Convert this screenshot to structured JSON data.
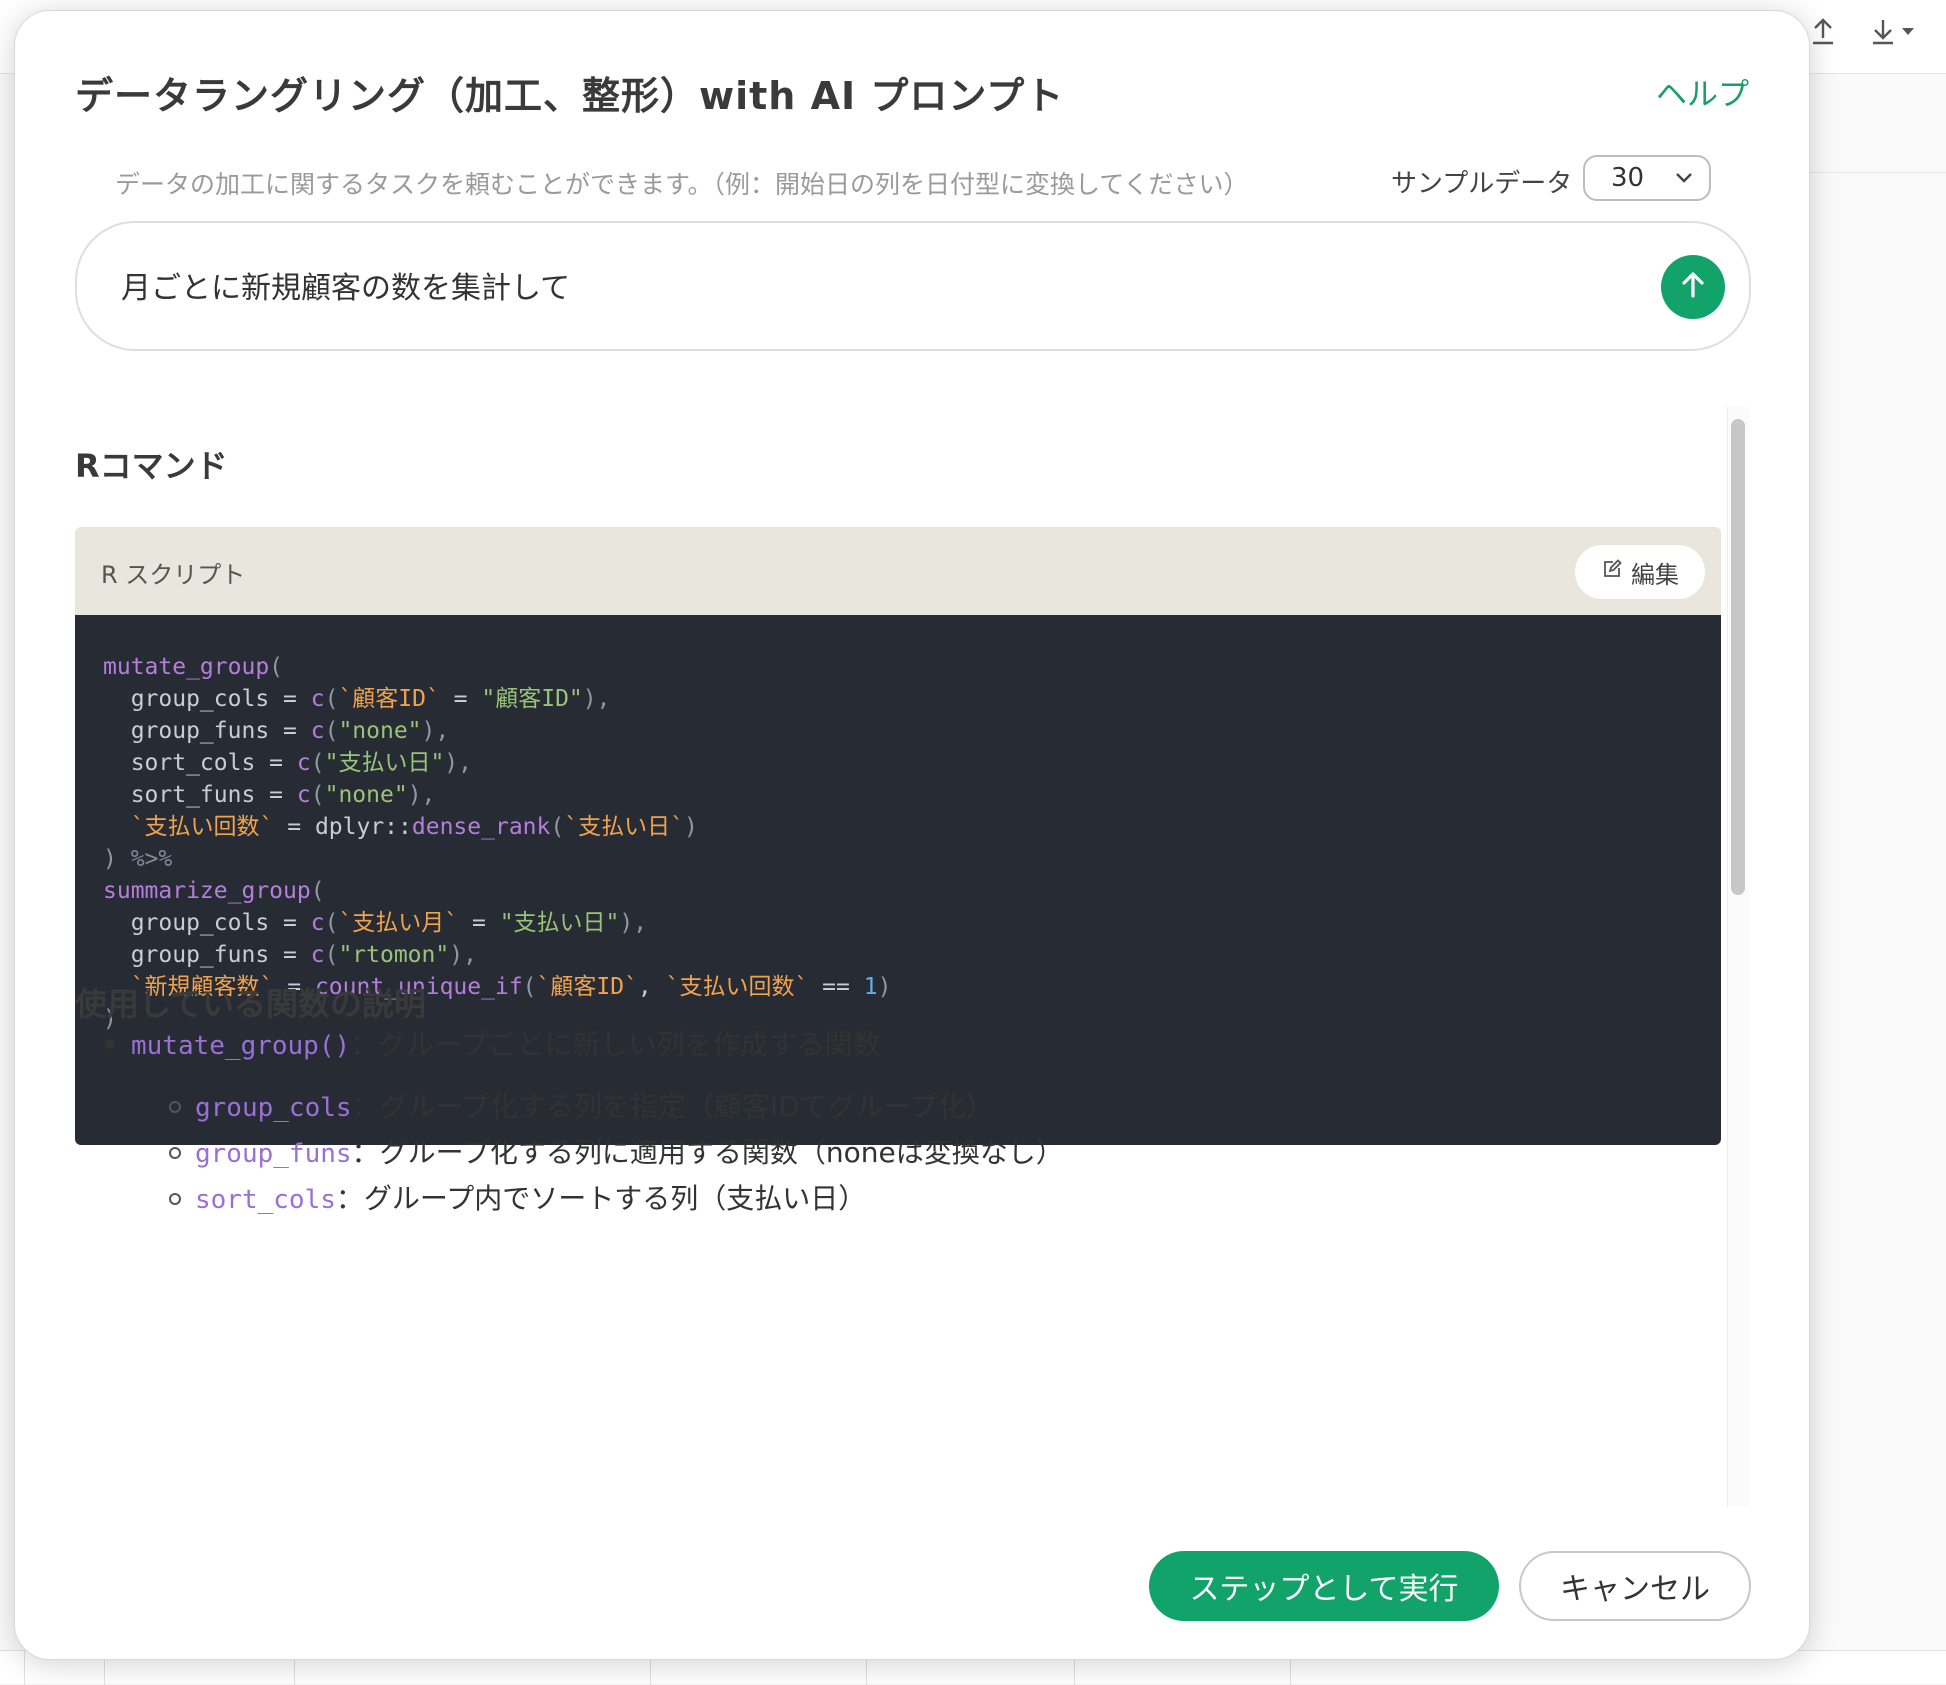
{
  "dialog": {
    "title": "データラングリング（加工、整形）with AI プロンプト",
    "help_label": "ヘルプ",
    "hint": "データの加工に関するタスクを頼むことができます。（例：開始日の列を日付型に変換してください）",
    "sample_label": "サンプルデータ",
    "sample_value": "30",
    "prompt_value": "月ごとに新規顧客の数を集計して"
  },
  "r_section": {
    "title": "Rコマンド",
    "script_label": "R スクリプト",
    "edit_label": "編集"
  },
  "code": {
    "lines": [
      [
        {
          "t": "fn",
          "v": "mutate_group"
        },
        {
          "t": "pun",
          "v": "("
        }
      ],
      [
        {
          "t": "pl",
          "v": "  group_cols = "
        },
        {
          "t": "fn",
          "v": "c"
        },
        {
          "t": "pun",
          "v": "("
        },
        {
          "t": "tick",
          "v": "`顧客ID`"
        },
        {
          "t": "pl",
          "v": " = "
        },
        {
          "t": "str",
          "v": "\"顧客ID\""
        },
        {
          "t": "pun",
          "v": "),"
        }
      ],
      [
        {
          "t": "pl",
          "v": "  group_funs = "
        },
        {
          "t": "fn",
          "v": "c"
        },
        {
          "t": "pun",
          "v": "("
        },
        {
          "t": "str",
          "v": "\"none\""
        },
        {
          "t": "pun",
          "v": "),"
        }
      ],
      [
        {
          "t": "pl",
          "v": "  sort_cols = "
        },
        {
          "t": "fn",
          "v": "c"
        },
        {
          "t": "pun",
          "v": "("
        },
        {
          "t": "str",
          "v": "\"支払い日\""
        },
        {
          "t": "pun",
          "v": "),"
        }
      ],
      [
        {
          "t": "pl",
          "v": "  sort_funs = "
        },
        {
          "t": "fn",
          "v": "c"
        },
        {
          "t": "pun",
          "v": "("
        },
        {
          "t": "str",
          "v": "\"none\""
        },
        {
          "t": "pun",
          "v": "),"
        }
      ],
      [
        {
          "t": "pl",
          "v": "  "
        },
        {
          "t": "tick",
          "v": "`支払い回数`"
        },
        {
          "t": "pl",
          "v": " = dplyr::"
        },
        {
          "t": "fn",
          "v": "dense_rank"
        },
        {
          "t": "pun",
          "v": "("
        },
        {
          "t": "tick",
          "v": "`支払い日`"
        },
        {
          "t": "pun",
          "v": ")"
        }
      ],
      [
        {
          "t": "pun",
          "v": ") "
        },
        {
          "t": "op",
          "v": "%>%"
        }
      ],
      [
        {
          "t": "fn",
          "v": "summarize_group"
        },
        {
          "t": "pun",
          "v": "("
        }
      ],
      [
        {
          "t": "pl",
          "v": "  group_cols = "
        },
        {
          "t": "fn",
          "v": "c"
        },
        {
          "t": "pun",
          "v": "("
        },
        {
          "t": "tick",
          "v": "`支払い月`"
        },
        {
          "t": "pl",
          "v": " = "
        },
        {
          "t": "str",
          "v": "\"支払い日\""
        },
        {
          "t": "pun",
          "v": "),"
        }
      ],
      [
        {
          "t": "pl",
          "v": "  group_funs = "
        },
        {
          "t": "fn",
          "v": "c"
        },
        {
          "t": "pun",
          "v": "("
        },
        {
          "t": "str",
          "v": "\"rtomon\""
        },
        {
          "t": "pun",
          "v": "),"
        }
      ],
      [
        {
          "t": "pl",
          "v": "  "
        },
        {
          "t": "tick",
          "v": "`新規顧客数`"
        },
        {
          "t": "pl",
          "v": " = "
        },
        {
          "t": "fn",
          "v": "count_unique_if"
        },
        {
          "t": "pun",
          "v": "("
        },
        {
          "t": "tick",
          "v": "`顧客ID`"
        },
        {
          "t": "pl",
          "v": ", "
        },
        {
          "t": "tick",
          "v": "`支払い回数`"
        },
        {
          "t": "pl",
          "v": " == "
        },
        {
          "t": "num",
          "v": "1"
        },
        {
          "t": "pun",
          "v": ")"
        }
      ],
      [
        {
          "t": "pun",
          "v": ")"
        }
      ]
    ]
  },
  "explanation": {
    "title": "使用している関数の説明",
    "items": [
      {
        "code": "mutate_group()",
        "sep": "：",
        "text": "グループごとに新しい列を作成する関数",
        "level": 1
      },
      {
        "code": "group_cols",
        "sep": "：",
        "text": "グループ化する列を指定（顧客IDでグループ化）",
        "level": 2
      },
      {
        "code": "group_funs",
        "sep": "：",
        "text": "グループ化する列に適用する関数（noneは変換なし）",
        "level": 2
      },
      {
        "code": "sort_cols",
        "sep": "：",
        "text": "グループ内でソートする列（支払い日）",
        "level": 2
      }
    ]
  },
  "footer": {
    "run_label": "ステップとして実行",
    "cancel_label": "キャンセル"
  },
  "colors": {
    "accent": "#12a36b",
    "code_bg": "#272b34",
    "code_header_bg": "#e8e6dd"
  },
  "icons": [
    "upload-icon",
    "download-icon",
    "chevron-down-icon",
    "send-arrow-icon",
    "edit-icon"
  ]
}
